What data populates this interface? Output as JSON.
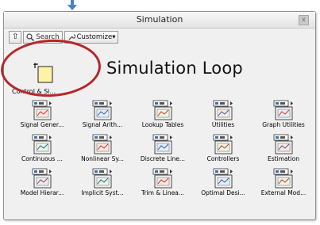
{
  "palette": {
    "title": "Simulation",
    "close_label": "x",
    "toolbar": {
      "up_label": "⇧",
      "search_label": "Search",
      "customize_label": "Customize▾"
    },
    "category": {
      "subpalette_label": "Control & Si...",
      "loop_title": "Simulation Loop"
    },
    "items": [
      {
        "label": "Signal Gener...",
        "icon": "signal-generator-icon"
      },
      {
        "label": "Signal Arith...",
        "icon": "signal-arithmetic-icon"
      },
      {
        "label": "Lookup Tables",
        "icon": "lookup-tables-icon"
      },
      {
        "label": "Utilities",
        "icon": "utilities-icon"
      },
      {
        "label": "Graph Utilities",
        "icon": "graph-utilities-icon"
      },
      {
        "label": "Continuous ...",
        "icon": "continuous-icon"
      },
      {
        "label": "Nonlinear Sy...",
        "icon": "nonlinear-systems-icon"
      },
      {
        "label": "Discrete Line...",
        "icon": "discrete-linear-icon"
      },
      {
        "label": "Controllers",
        "icon": "controllers-icon"
      },
      {
        "label": "Estimation",
        "icon": "estimation-icon"
      },
      {
        "label": "Model Hierar...",
        "icon": "model-hierarchy-icon"
      },
      {
        "label": "Implicit Syst...",
        "icon": "implicit-systems-icon"
      },
      {
        "label": "Trim & Linea...",
        "icon": "trim-linearize-icon"
      },
      {
        "label": "Optimal Desi...",
        "icon": "optimal-design-icon"
      },
      {
        "label": "External Mod...",
        "icon": "external-model-icon"
      }
    ]
  },
  "colors": {
    "highlight_ring": "#b5262a",
    "pointer_arrow": "#4a7fd0",
    "subpalette_fill": "#fdf3a8"
  }
}
